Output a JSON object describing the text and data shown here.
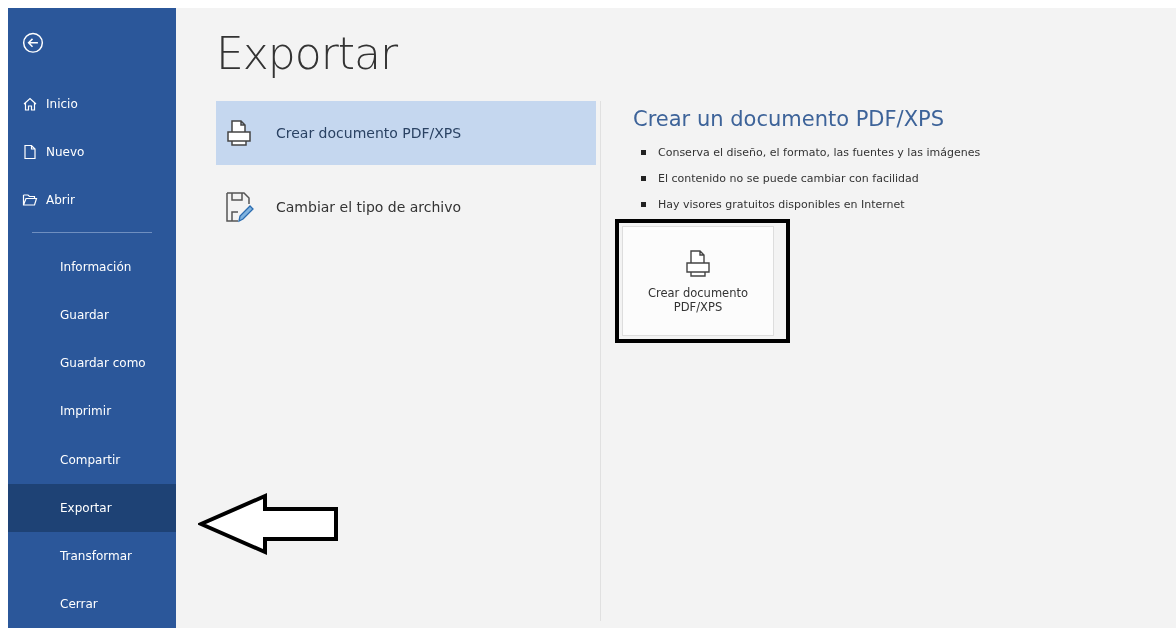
{
  "sidebar": {
    "items": [
      {
        "label": "Inicio",
        "kind": "home",
        "selected": false
      },
      {
        "label": "Nuevo",
        "kind": "new",
        "selected": false
      },
      {
        "label": "Abrir",
        "kind": "open",
        "selected": false
      },
      {
        "label": "Información",
        "kind": "command",
        "selected": false
      },
      {
        "label": "Guardar",
        "kind": "command",
        "selected": false
      },
      {
        "label": "Guardar como",
        "kind": "command",
        "selected": false
      },
      {
        "label": "Imprimir",
        "kind": "command",
        "selected": false
      },
      {
        "label": "Compartir",
        "kind": "command",
        "selected": false
      },
      {
        "label": "Exportar",
        "kind": "command",
        "selected": true
      },
      {
        "label": "Transformar",
        "kind": "command",
        "selected": false
      },
      {
        "label": "Cerrar",
        "kind": "command",
        "selected": false
      }
    ]
  },
  "page": {
    "title": "Exportar"
  },
  "options": [
    {
      "label": "Crear documento PDF/XPS",
      "kind": "pdf",
      "selected": true
    },
    {
      "label": "Cambiar el tipo de archivo",
      "kind": "filetype",
      "selected": false
    }
  ],
  "detail": {
    "title": "Crear un documento PDF/XPS",
    "bullets": [
      "Conserva el diseño, el formato, las fuentes y las imágenes",
      "El contenido no se puede cambiar con facilidad",
      "Hay visores gratuitos disponibles en Internet"
    ],
    "button": "Crear documento PDF/XPS"
  }
}
